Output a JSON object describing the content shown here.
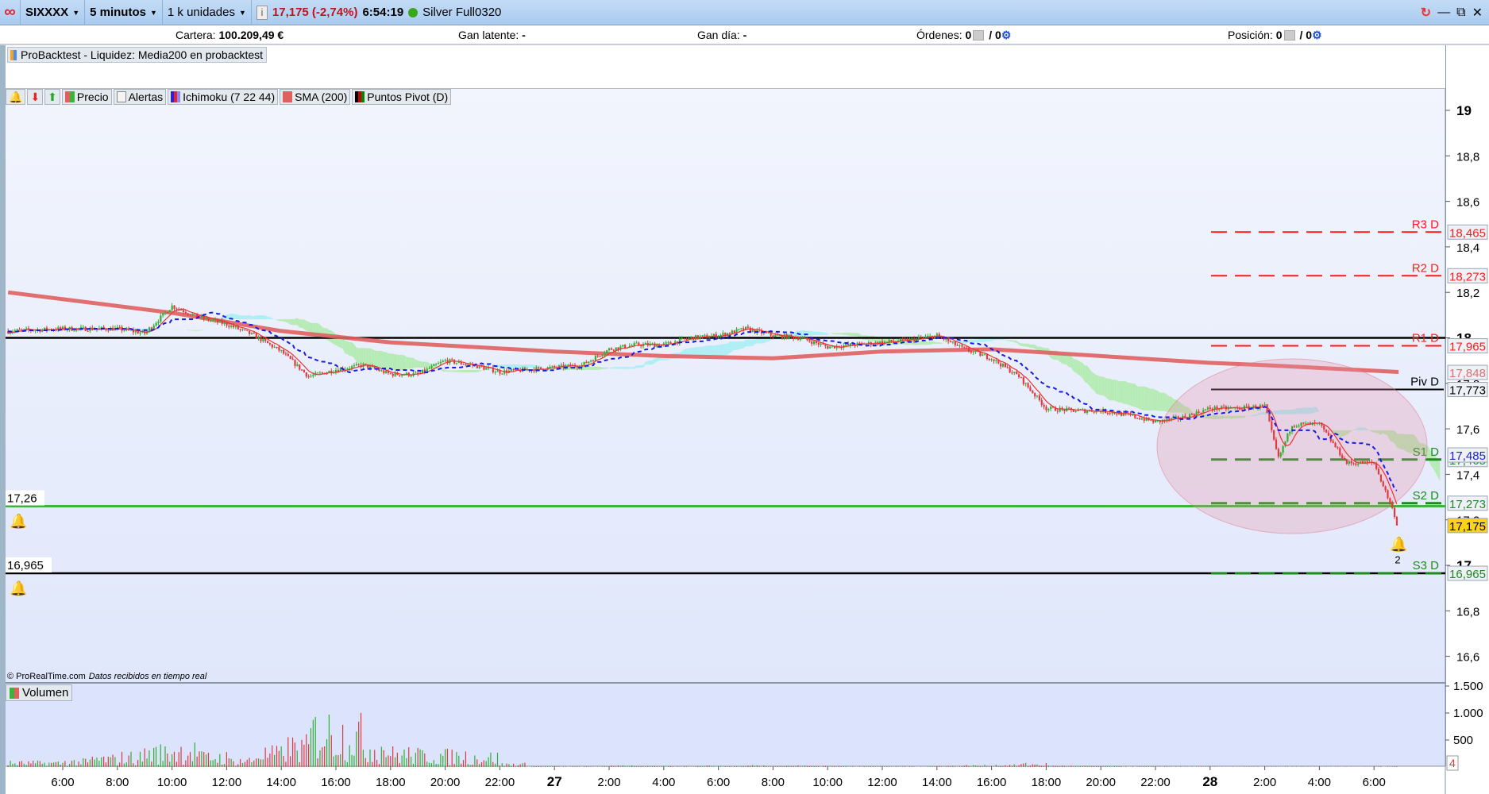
{
  "toolbar": {
    "symbol": "SIXXXX",
    "timeframe": "5 minutos",
    "units": "1 k unidades",
    "info_icon": "i",
    "price_change": "17,175 (-2,74%)",
    "time": "6:54:19",
    "account": "Silver Full0320"
  },
  "infobar": {
    "cartera_label": "Cartera:",
    "cartera_value": "100.209,49 €",
    "gan_latente_label": "Gan latente:",
    "gan_latente_value": "-",
    "gan_dia_label": "Gan día:",
    "gan_dia_value": "-",
    "ordenes_label": "Órdenes:",
    "ordenes_value": "0",
    "ordenes_total": "/ 0",
    "posicion_label": "Posición:",
    "posicion_value": "0",
    "posicion_total": "/ 0"
  },
  "backtest": {
    "label": "ProBacktest - Liquidez: Media200 en probacktest"
  },
  "legend": {
    "precio": "Precio",
    "alertas": "Alertas",
    "ichimoku": "Ichimoku (7 22 44)",
    "sma": "SMA (200)",
    "pivot": "Puntos Pivot (D)"
  },
  "volume_legend": "Volumen",
  "copyright": "© ProRealTime.com",
  "copyright_note": "Datos recibidos en tiempo real",
  "colors": {
    "up": "#2fb02f",
    "down": "#e0393e",
    "sma": "#e06060",
    "kijun": "#1a1ae6",
    "pivot_r": "#ff1a1a",
    "pivot_s": "#1f8a1f",
    "alert_line": "#3cb43c"
  },
  "chart_data": {
    "type": "candlestick",
    "price_axis": {
      "ylim": [
        16.5,
        19.05
      ],
      "ticks": [
        "19",
        "18,8",
        "18,6",
        "18,4",
        "18,2",
        "18",
        "17,8",
        "17,6",
        "17,4",
        "17,2",
        "17",
        "16,8",
        "16,6"
      ],
      "tick_values": [
        19,
        18.8,
        18.6,
        18.4,
        18.2,
        18,
        17.8,
        17.6,
        17.4,
        17.2,
        17,
        16.8,
        16.6
      ]
    },
    "time_axis": {
      "labels": [
        "6:00",
        "8:00",
        "10:00",
        "12:00",
        "14:00",
        "16:00",
        "18:00",
        "20:00",
        "22:00",
        "27",
        "2:00",
        "4:00",
        "6:00",
        "8:00",
        "10:00",
        "12:00",
        "14:00",
        "16:00",
        "18:00",
        "20:00",
        "22:00",
        "28",
        "2:00",
        "4:00",
        "6:00"
      ]
    },
    "price": {
      "hours_from_26_0600": [
        -2,
        0,
        2,
        3,
        4,
        5,
        6,
        7,
        8,
        9,
        10,
        11,
        12,
        13,
        14,
        15,
        16,
        17,
        18,
        19,
        20,
        21,
        22,
        23,
        24,
        25,
        26,
        27,
        28,
        29,
        30,
        31,
        32,
        33,
        34,
        35,
        36,
        37,
        38,
        39,
        40,
        41,
        42,
        43,
        44,
        44.5,
        45,
        46,
        47,
        48,
        48.5,
        48.9
      ],
      "close": [
        18.03,
        18.04,
        18.04,
        18.02,
        18.14,
        18.09,
        18.06,
        18.01,
        17.94,
        17.83,
        17.86,
        17.88,
        17.84,
        17.84,
        17.9,
        17.88,
        17.85,
        17.86,
        17.87,
        17.88,
        17.95,
        17.97,
        17.97,
        18.0,
        18.01,
        18.04,
        18.01,
        18.0,
        17.96,
        17.97,
        17.98,
        17.99,
        18.01,
        17.95,
        17.91,
        17.83,
        17.69,
        17.68,
        17.68,
        17.66,
        17.63,
        17.65,
        17.69,
        17.69,
        17.7,
        17.47,
        17.62,
        17.62,
        17.45,
        17.45,
        17.3,
        17.175
      ]
    },
    "sma200": {
      "hours_from_26_0600": [
        -2,
        4,
        8,
        12,
        18,
        22,
        26,
        30,
        34,
        38,
        42,
        44,
        48.9
      ],
      "value": [
        18.2,
        18.11,
        18.03,
        17.98,
        17.94,
        17.92,
        17.91,
        17.94,
        17.95,
        17.92,
        17.89,
        17.88,
        17.85
      ]
    },
    "volume": {
      "axis_ticks": [
        "1.500",
        "1.000",
        "500"
      ],
      "axis_values": [
        1500,
        1000,
        500
      ],
      "last_value": "4",
      "hourly_avg_from_26_0400": [
        60,
        60,
        80,
        120,
        150,
        220,
        250,
        150,
        100,
        200,
        300,
        550,
        500,
        300,
        200,
        180,
        170,
        150,
        40,
        10,
        5,
        5,
        20,
        10,
        8,
        15,
        10,
        20,
        15,
        15,
        10,
        8,
        5,
        5,
        15,
        20,
        25,
        40,
        15,
        12,
        8,
        5,
        5,
        3,
        3,
        3,
        3,
        3,
        2,
        2,
        5
      ]
    },
    "pivots": [
      {
        "label": "R3 D",
        "value": 18.465,
        "text": "18,465",
        "type": "r"
      },
      {
        "label": "R2 D",
        "value": 18.273,
        "text": "18,273",
        "type": "r"
      },
      {
        "label": "R1 D",
        "value": 17.965,
        "text": "17,965",
        "type": "r"
      },
      {
        "label": "Piv D",
        "value": 17.773,
        "text": "17,773",
        "type": "p"
      },
      {
        "label": "S1 D",
        "value": 17.465,
        "text": "17,465",
        "type": "s"
      },
      {
        "label": "S2 D",
        "value": 17.273,
        "text": "17,273",
        "type": "s"
      },
      {
        "label": "S3 D",
        "value": 16.965,
        "text": "16,965",
        "type": "s"
      }
    ],
    "value_tags": [
      {
        "text": "17,848",
        "value": 17.848,
        "color": "#e07070"
      },
      {
        "text": "17,485",
        "value": 17.485,
        "color": "#1a1ae6"
      },
      {
        "text": "17,175",
        "value": 17.175,
        "color": "#000",
        "bg": "#ffd21a"
      }
    ],
    "horizontal_lines": [
      {
        "value": 18.0,
        "color": "#000",
        "label": ""
      },
      {
        "value": 17.26,
        "color": "#3cb43c",
        "label": "17,26"
      },
      {
        "value": 16.965,
        "color": "#000",
        "label": "16,965"
      }
    ],
    "alert_marker": {
      "count": "2",
      "value": 17.12
    }
  }
}
